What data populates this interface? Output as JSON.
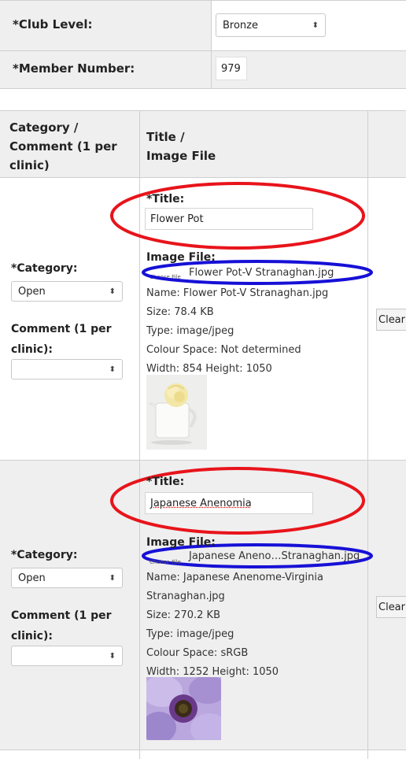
{
  "club": {
    "level_label": "*Club Level:",
    "level_value": "Bronze",
    "member_label": "*Member Number:",
    "member_value": "979"
  },
  "table": {
    "headers": [
      "Category / Comment (1 per clinic)",
      "Title / Image File"
    ],
    "header_col1_lines": [
      "Category /",
      "Comment (1 per",
      "clinic)"
    ],
    "header_col2_lines": [
      "Title /",
      "Image File"
    ]
  },
  "entries": [
    {
      "category_label": "*Category:",
      "category_value": "Open",
      "comment_label_lines": [
        "Comment (1 per",
        "clinic):"
      ],
      "comment_value": "",
      "title_label": "*Title:",
      "title_value": "Flower Pot",
      "image_file_label": "Image File:",
      "choose_file": "Choose File",
      "file_chosen": "Flower Pot-V Stranaghan.jpg",
      "name_line": "Name: Flower Pot-V Stranaghan.jpg",
      "size_line": "Size: 78.4 KB",
      "type_line": "Type: image/jpeg",
      "colour_line": "Colour Space: Not determined",
      "dims_line": "Width: 854 Height: 1050",
      "clear": "Clear"
    },
    {
      "category_label": "*Category:",
      "category_value": "Open",
      "comment_label_lines": [
        "Comment (1 per",
        "clinic):"
      ],
      "comment_value": "",
      "title_label": "*Title:",
      "title_value": "Japanese Anenomia",
      "image_file_label": "Image File:",
      "choose_file": "Choose File",
      "file_chosen": "Japanese Aneno…Stranaghan.jpg",
      "name_line_1": "Name: Japanese Anenome-Virginia",
      "name_line_2": "Stranaghan.jpg",
      "size_line": "Size: 270.2 KB",
      "type_line": "Type: image/jpeg",
      "colour_line": "Colour Space: sRGB",
      "dims_line": "Width: 1252 Height: 1050",
      "clear": "Clear"
    }
  ],
  "annotation_colors": {
    "title_ellipse": "#e8141b",
    "file_ellipse": "#1610d6"
  },
  "select_arrow": "⬍"
}
